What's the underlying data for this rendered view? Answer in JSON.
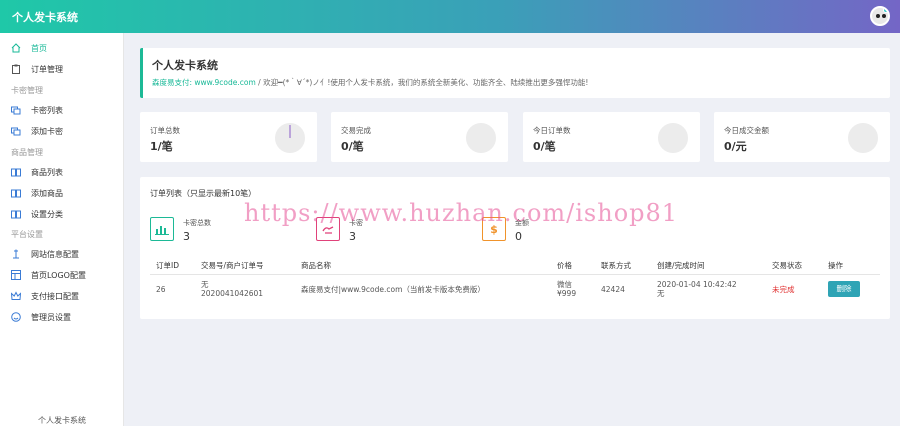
{
  "app": {
    "title": "个人发卡系统"
  },
  "colors": {
    "accent": "#17b897",
    "header_start": "#1fc8a8",
    "header_end": "#7466c6",
    "danger": "#e02e2e",
    "button": "#2fa4b5"
  },
  "sidebar": {
    "items": [
      {
        "label": "首页",
        "icon": "home-icon"
      },
      {
        "label": "订单管理",
        "icon": "clipboard-icon"
      },
      {
        "label": "卡密列表",
        "icon": "cards-icon"
      },
      {
        "label": "添加卡密",
        "icon": "cards-icon"
      },
      {
        "label": "商品列表",
        "icon": "book-icon"
      },
      {
        "label": "添加商品",
        "icon": "book-icon"
      },
      {
        "label": "设置分类",
        "icon": "book-icon"
      },
      {
        "label": "网站信息配置",
        "icon": "pin-icon"
      },
      {
        "label": "首页LOGO配置",
        "icon": "layout-icon"
      },
      {
        "label": "支付接口配置",
        "icon": "crown-icon"
      },
      {
        "label": "管理员设置",
        "icon": "smile-icon"
      }
    ],
    "groups": [
      "卡密管理",
      "商品管理",
      "平台设置"
    ],
    "footer": "个人发卡系统"
  },
  "welcome": {
    "title": "个人发卡系统",
    "link": "森度易支付: www.9code.com",
    "message": " / 欢迎━(*｀∀´*)ノ亻!使用个人发卡系统，我们的系统全新美化、功能齐全、陆续推出更多强悍功能!"
  },
  "stats": [
    {
      "label": "订单总数",
      "value": "1/笔"
    },
    {
      "label": "交易完成",
      "value": "0/笔"
    },
    {
      "label": "今日订单数",
      "value": "0/笔"
    },
    {
      "label": "今日成交金额",
      "value": "0/元"
    }
  ],
  "orders": {
    "title": "订单列表（只显示最新10笔）",
    "mini_stats": [
      {
        "label": "卡密总数",
        "value": "3",
        "icon": "chart-icon"
      },
      {
        "label": "卡密",
        "value": "3",
        "icon": "hand-icon"
      },
      {
        "label": "金额",
        "value": "0",
        "icon": "dollar-icon"
      }
    ],
    "columns": [
      "订单ID",
      "交易号/商户订单号",
      "商品名称",
      "价格",
      "联系方式",
      "创建/完成时间",
      "交易状态",
      "操作"
    ],
    "rows": [
      {
        "id": "26",
        "trade_no": "无",
        "merchant_no": "2020041042601",
        "product": "森度易支付|www.9code.com（当前发卡版本免费版）",
        "pay_method": "微信",
        "price": "¥999",
        "contact": "42424",
        "created": "2020-01-04 10:42:42",
        "completed": "无",
        "status": "未完成",
        "action": "删除"
      }
    ]
  },
  "watermark": "https://www.huzhan.com/ishop81"
}
